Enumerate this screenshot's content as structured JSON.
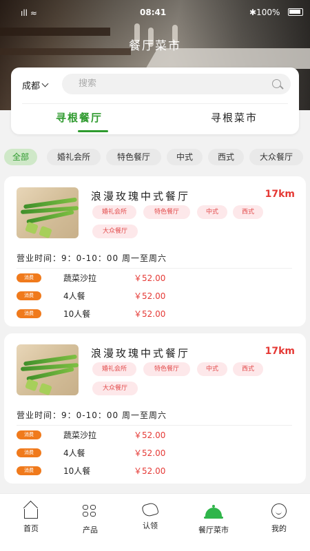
{
  "status_bar": {
    "signal": "ıll ≈",
    "time": "08:41",
    "battery": "✱100%"
  },
  "header": {
    "title": "餐厅菜市"
  },
  "search": {
    "city": "成都",
    "placeholder": "搜索"
  },
  "tabs": [
    {
      "label": "寻根餐厅",
      "active": true
    },
    {
      "label": "寻根菜市",
      "active": false
    }
  ],
  "filters": [
    {
      "label": "全部",
      "active": true
    },
    {
      "label": "婚礼会所",
      "active": false
    },
    {
      "label": "特色餐厅",
      "active": false
    },
    {
      "label": "中式",
      "active": false
    },
    {
      "label": "西式",
      "active": false
    },
    {
      "label": "大众餐厅",
      "active": false
    }
  ],
  "restaurants": [
    {
      "name": "浪漫玫瑰中式餐厅",
      "distance": "17km",
      "tags": [
        "婚礼会所",
        "特色餐厅",
        "中式",
        "西式",
        "大众餐厅"
      ],
      "hours": "营业时间：9：0-10：00 周一至周六",
      "deals": [
        {
          "badge": "消费",
          "item": "蔬菜沙拉",
          "price": "￥52.00"
        },
        {
          "badge": "消费",
          "item": "4人餐",
          "price": "￥52.00"
        },
        {
          "badge": "消费",
          "item": "10人餐",
          "price": "￥52.00"
        }
      ]
    },
    {
      "name": "浪漫玫瑰中式餐厅",
      "distance": "17km",
      "tags": [
        "婚礼会所",
        "特色餐厅",
        "中式",
        "西式",
        "大众餐厅"
      ],
      "hours": "营业时间：9：0-10：00 周一至周六",
      "deals": [
        {
          "badge": "消费",
          "item": "蔬菜沙拉",
          "price": "￥52.00"
        },
        {
          "badge": "消费",
          "item": "4人餐",
          "price": "￥52.00"
        },
        {
          "badge": "消费",
          "item": "10人餐",
          "price": "￥52.00"
        }
      ]
    }
  ],
  "bottom_nav": [
    {
      "label": "首页",
      "icon": "home-icon",
      "active": false
    },
    {
      "label": "产品",
      "icon": "product-icon",
      "active": false
    },
    {
      "label": "认领",
      "icon": "claim-icon",
      "active": false
    },
    {
      "label": "餐厅菜市",
      "icon": "cloche-icon",
      "active": true
    },
    {
      "label": "我的",
      "icon": "profile-icon",
      "active": false
    }
  ],
  "colors": {
    "accent_green": "#2e9a2e",
    "price_red": "#e53935",
    "badge_orange": "#f07a1c"
  }
}
